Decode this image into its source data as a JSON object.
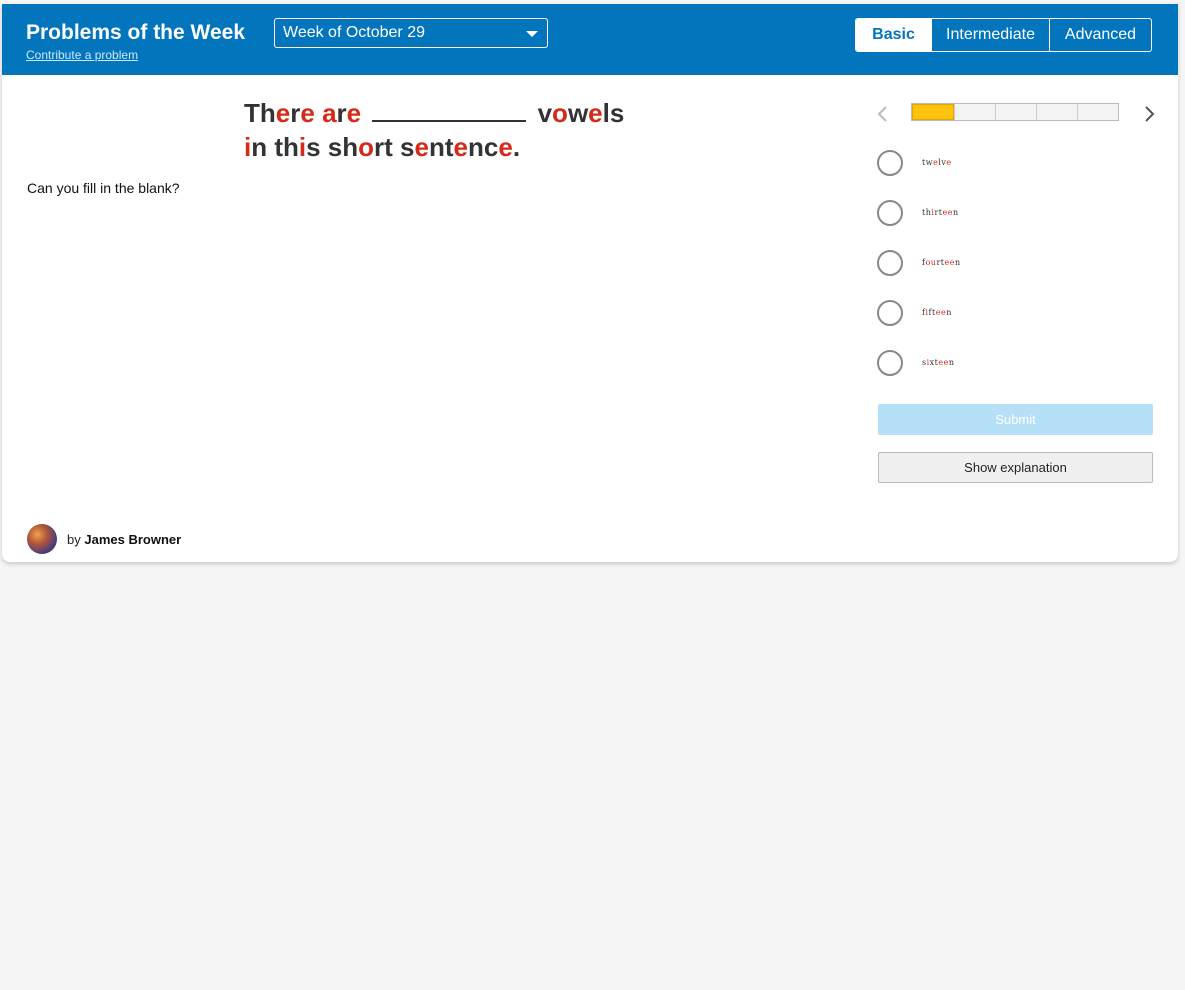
{
  "header": {
    "title": "Problems of the Week",
    "contribute_link": "Contribute a problem",
    "week_select": "Week of October 29",
    "levels": [
      {
        "label": "Basic",
        "active": true
      },
      {
        "label": "Intermediate",
        "active": false
      },
      {
        "label": "Advanced",
        "active": false
      }
    ]
  },
  "problem": {
    "question_line1": [
      "Th",
      "e",
      "r",
      "e",
      " ",
      "a",
      "r",
      "e",
      " ",
      "__BLANK__",
      " v",
      "o",
      "w",
      "e",
      "ls"
    ],
    "question_line2": [
      "",
      "i",
      "n th",
      "i",
      "s sh",
      "o",
      "rt s",
      "e",
      "nt",
      "e",
      "nc",
      "e",
      "."
    ],
    "prompt": "Can you fill in the blank?"
  },
  "progress": {
    "segments_total": 5,
    "segments_completed": 1
  },
  "choices": [
    {
      "parts": [
        {
          "t": "tw",
          "v": false
        },
        {
          "t": "e",
          "v": true
        },
        {
          "t": "lv",
          "v": false
        },
        {
          "t": "e",
          "v": true
        }
      ]
    },
    {
      "parts": [
        {
          "t": "th",
          "v": false
        },
        {
          "t": "i",
          "v": true
        },
        {
          "t": "rt",
          "v": false
        },
        {
          "t": "ee",
          "v": true
        },
        {
          "t": "n",
          "v": false
        }
      ]
    },
    {
      "parts": [
        {
          "t": "f",
          "v": false
        },
        {
          "t": "ou",
          "v": true
        },
        {
          "t": "rt",
          "v": false
        },
        {
          "t": "ee",
          "v": true
        },
        {
          "t": "n",
          "v": false
        }
      ]
    },
    {
      "parts": [
        {
          "t": "f",
          "v": false
        },
        {
          "t": "i",
          "v": true
        },
        {
          "t": "ft",
          "v": false
        },
        {
          "t": "ee",
          "v": true
        },
        {
          "t": "n",
          "v": false
        }
      ]
    },
    {
      "parts": [
        {
          "t": "s",
          "v": false
        },
        {
          "t": "i",
          "v": true
        },
        {
          "t": "xt",
          "v": false
        },
        {
          "t": "ee",
          "v": true
        },
        {
          "t": "n",
          "v": false
        }
      ]
    }
  ],
  "actions": {
    "submit": "Submit",
    "show_explanation": "Show explanation"
  },
  "author": {
    "prefix": "by",
    "name": "James Browner"
  },
  "colors": {
    "header_blue": "#0375bd",
    "vowel_red": "#d42a1a",
    "progress_yellow": "#ffc20e",
    "submit_disabled": "#b6e0f7"
  },
  "icons": {
    "prev": "chevron-left-icon",
    "next": "chevron-right-icon",
    "select_caret": "caret-down-icon"
  }
}
